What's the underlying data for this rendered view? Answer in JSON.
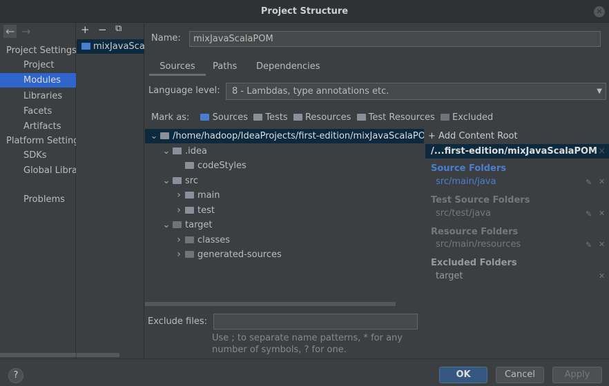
{
  "window": {
    "title": "Project Structure"
  },
  "sidebar": {
    "section1": "Project Settings",
    "items1": [
      "Project",
      "Modules",
      "Libraries",
      "Facets",
      "Artifacts"
    ],
    "section2": "Platform Settings",
    "items2": [
      "SDKs",
      "Global Libraries"
    ],
    "problems": "Problems",
    "selected": "Modules"
  },
  "modules": {
    "items": [
      "mixJavaScalaPOM"
    ]
  },
  "main": {
    "name_label": "Name:",
    "name_value": "mixJavaScalaPOM",
    "tabs": [
      "Sources",
      "Paths",
      "Dependencies"
    ],
    "active_tab": "Sources",
    "language_label": "Language level:",
    "language_value": "8 - Lambdas, type annotations etc.",
    "mark_as_label": "Mark as:",
    "mark_as": [
      "Sources",
      "Tests",
      "Resources",
      "Test Resources",
      "Excluded"
    ],
    "tree": [
      {
        "label": "/home/hadoop/IdeaProjects/first-edition/mixJavaScalaPOM",
        "depth": 0,
        "expanded": true
      },
      {
        "label": ".idea",
        "depth": 1,
        "expanded": true
      },
      {
        "label": "codeStyles",
        "depth": 2,
        "expanded": null
      },
      {
        "label": "src",
        "depth": 1,
        "expanded": true
      },
      {
        "label": "main",
        "depth": 2,
        "expanded": false
      },
      {
        "label": "test",
        "depth": 2,
        "expanded": false
      },
      {
        "label": "target",
        "depth": 1,
        "expanded": true
      },
      {
        "label": "classes",
        "depth": 2,
        "expanded": false
      },
      {
        "label": "generated-sources",
        "depth": 2,
        "expanded": false
      }
    ],
    "exclude_label": "Exclude files:",
    "exclude_value": "",
    "exclude_hint1": "Use ; to separate name patterns, * for any",
    "exclude_hint2": "number of symbols, ? for one."
  },
  "content_root": {
    "add_label": "+ Add Content Root",
    "root": "/...first-edition/mixJavaScalaPOM",
    "source_header": "Source Folders",
    "source": "src/main/java",
    "test_header": "Test Source Folders",
    "test": "src/test/java",
    "resource_header": "Resource Folders",
    "resource": "src/main/resources",
    "excluded_header": "Excluded Folders",
    "excluded": "target"
  },
  "footer": {
    "help": "?",
    "ok": "OK",
    "cancel": "Cancel",
    "apply": "Apply"
  },
  "colors": {
    "accent": "#2f65ca",
    "source_blue": "#4a7ed0",
    "ok_button": "#365880"
  }
}
